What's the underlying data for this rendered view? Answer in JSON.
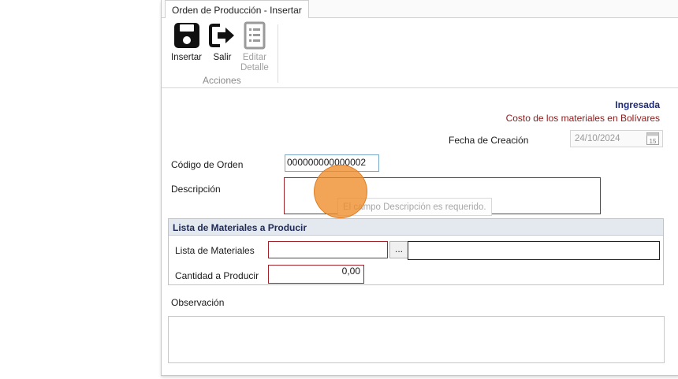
{
  "tab": {
    "title": "Orden de Producción - Insertar"
  },
  "ribbon": {
    "insert_label": "Insertar",
    "exit_label": "Salir",
    "edit_detail_line1": "Editar",
    "edit_detail_line2": "Detalle",
    "group_label": "Acciones"
  },
  "header": {
    "status": "Ingresada",
    "currency_note": "Costo de los materiales en Bolívares",
    "date_label": "Fecha de Creación",
    "date_value": "24/10/2024",
    "calendar_day": "15"
  },
  "form": {
    "order_code_label": "Código de Orden",
    "order_code_value": "000000000000002",
    "description_label": "Descripción",
    "description_value": "",
    "description_error": "El campo Descripción es requerido."
  },
  "materials": {
    "title": "Lista de Materiales a Producir",
    "list_label": "Lista de Materiales",
    "list_value": "",
    "browse_label": "...",
    "list_name_value": "",
    "qty_label": "Cantidad a Producir",
    "qty_value": "0,00"
  },
  "notes": {
    "label": "Observación",
    "value": ""
  },
  "colors": {
    "error_border": "#a3232a",
    "status_text": "#1d2a7a",
    "currency_text": "#8b1a1a",
    "cursor_highlight": "#f08c28"
  }
}
